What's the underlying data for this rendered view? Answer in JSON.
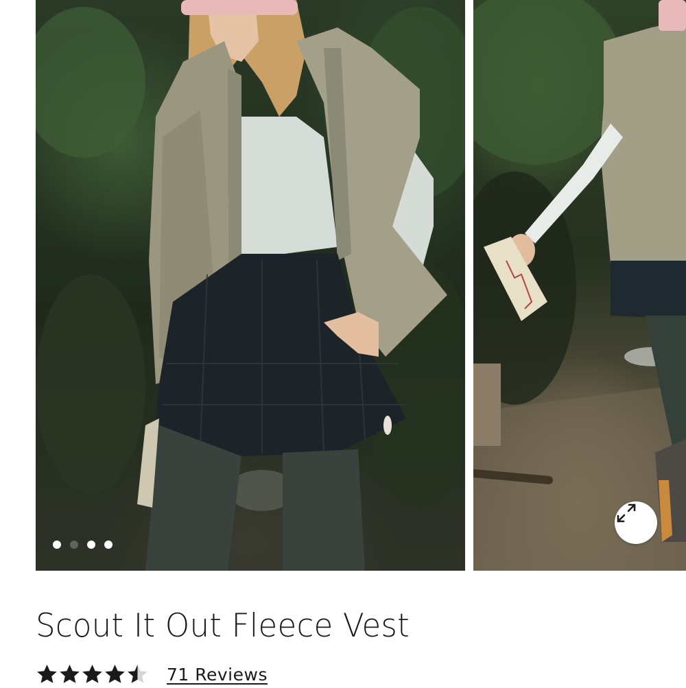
{
  "gallery": {
    "images": [
      {
        "alt": "model-front"
      },
      {
        "alt": "model-side"
      }
    ],
    "dots_count": 4,
    "active_dot": 0
  },
  "product": {
    "title": "Scout It Out Fleece Vest",
    "rating": 4.5,
    "rating_max": 5,
    "reviews_label": "71 Reviews"
  },
  "icons": {
    "expand": "expand-arrows-icon",
    "star": "star-icon"
  },
  "colors": {
    "star_fill": "#1a1a1a",
    "star_empty": "#d6d6d6",
    "text": "#1a1a1a"
  }
}
